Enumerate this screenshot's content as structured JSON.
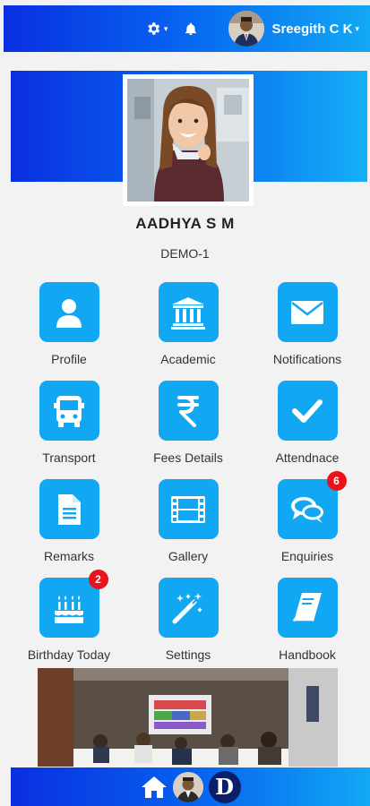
{
  "header": {
    "user_name": "Sreegith C K",
    "caret": "▾"
  },
  "student": {
    "name": "AADHYA S M",
    "class": "DEMO-1"
  },
  "menu": [
    {
      "label": "Profile",
      "icon": "user-icon"
    },
    {
      "label": "Academic",
      "icon": "institution-icon"
    },
    {
      "label": "Notifications",
      "icon": "envelope-icon"
    },
    {
      "label": "Transport",
      "icon": "bus-icon"
    },
    {
      "label": "Fees Details",
      "icon": "rupee-icon"
    },
    {
      "label": "Attendnace",
      "icon": "check-icon"
    },
    {
      "label": "Remarks",
      "icon": "document-icon"
    },
    {
      "label": "Gallery",
      "icon": "film-icon"
    },
    {
      "label": "Enquiries",
      "icon": "chat-bubbles-icon",
      "badge": "6"
    },
    {
      "label": "Birthday Today",
      "icon": "birthday-cake-icon",
      "badge": "2"
    },
    {
      "label": "Settings",
      "icon": "magic-wand-icon"
    },
    {
      "label": "Handbook",
      "icon": "book-icon"
    }
  ],
  "bottom_bar": {
    "logo_letter": "D"
  },
  "colors": {
    "header_gradient_start": "#0a2fe0",
    "header_gradient_end": "#12a8f5",
    "icon_tile": "#12a7f2",
    "badge": "#e8131b"
  }
}
